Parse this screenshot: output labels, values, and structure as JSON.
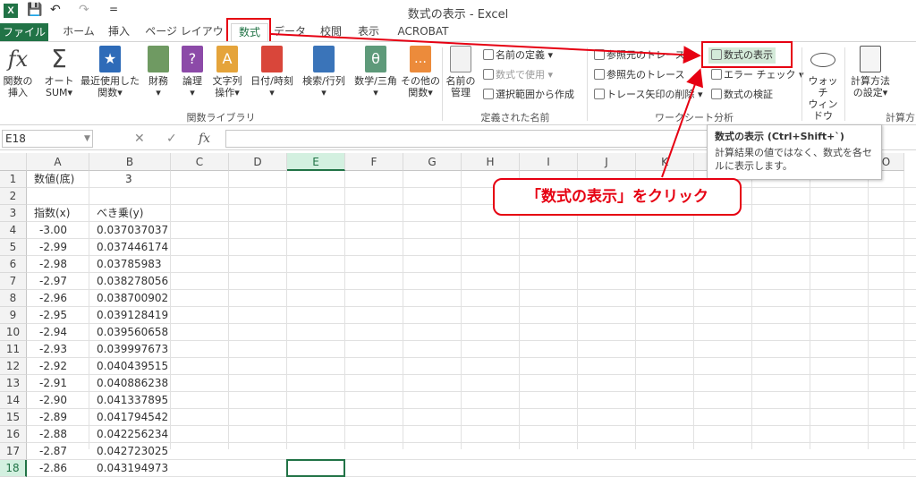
{
  "window": {
    "title": "数式の表示 - Excel",
    "app_icon_letter": "X"
  },
  "quick_access": {
    "save": "💾",
    "undo": "↶",
    "redo": "↷",
    "customize": "="
  },
  "tabs": [
    "ファイル",
    "ホーム",
    "挿入",
    "ページ レイアウト",
    "数式",
    "データ",
    "校閲",
    "表示",
    "ACROBAT"
  ],
  "ribbon": {
    "insert_function": [
      "関数の",
      "挿入"
    ],
    "autosum": [
      "オート",
      "SUM▾"
    ],
    "recent": [
      "最近使用した",
      "関数▾"
    ],
    "finance": [
      "財務",
      "▾"
    ],
    "logical": [
      "論理",
      "▾"
    ],
    "text": [
      "文字列",
      "操作▾"
    ],
    "datetime": [
      "日付/時刻",
      "▾"
    ],
    "lookup": [
      "検索/行列",
      "▾"
    ],
    "math": [
      "数学/三角",
      "▾"
    ],
    "other": [
      "その他の",
      "関数▾"
    ],
    "group_library": "関数ライブラリ",
    "name_manager": [
      "名前の",
      "管理"
    ],
    "define_name": "名前の定義 ▾",
    "use_in_formula": "数式で使用 ▾",
    "create_from_selection": "選択範囲から作成",
    "group_names": "定義された名前",
    "trace_precedents": "参照元のトレース",
    "trace_dependents": "参照先のトレース",
    "remove_arrows": "トレース矢印の削除 ▾",
    "show_formulas": "数式の表示",
    "error_check": "エラー チェック ▾",
    "evaluate_formula": "数式の検証",
    "group_audit": "ワークシート分析",
    "watch_window": [
      "ウォッチ",
      "ウィンドウ"
    ],
    "calc_options": [
      "計算方法",
      "の設定▾"
    ],
    "group_calc": "計算方"
  },
  "formula_bar": {
    "name_box": "E18",
    "fx": "fx"
  },
  "tooltip": {
    "title": "数式の表示 (Ctrl+Shift+`)",
    "body": "計算結果の値ではなく、数式を各セルに表示します。"
  },
  "callout": "「数式の表示」をクリック",
  "columns": [
    "A",
    "B",
    "C",
    "D",
    "E",
    "F",
    "G",
    "H",
    "I",
    "J",
    "K",
    "L",
    "M",
    "N",
    "O"
  ],
  "rows": [
    {
      "n": "1",
      "a": "数値(底)",
      "b": "3"
    },
    {
      "n": "2",
      "a": "",
      "b": ""
    },
    {
      "n": "3",
      "a": "指数(x)",
      "b": "べき乗(y)"
    },
    {
      "n": "4",
      "a": "-3.00",
      "b": "0.037037037"
    },
    {
      "n": "5",
      "a": "-2.99",
      "b": "0.037446174"
    },
    {
      "n": "6",
      "a": "-2.98",
      "b": "0.03785983"
    },
    {
      "n": "7",
      "a": "-2.97",
      "b": "0.038278056"
    },
    {
      "n": "8",
      "a": "-2.96",
      "b": "0.038700902"
    },
    {
      "n": "9",
      "a": "-2.95",
      "b": "0.039128419"
    },
    {
      "n": "10",
      "a": "-2.94",
      "b": "0.039560658"
    },
    {
      "n": "11",
      "a": "-2.93",
      "b": "0.039997673"
    },
    {
      "n": "12",
      "a": "-2.92",
      "b": "0.040439515"
    },
    {
      "n": "13",
      "a": "-2.91",
      "b": "0.040886238"
    },
    {
      "n": "14",
      "a": "-2.90",
      "b": "0.041337895"
    },
    {
      "n": "15",
      "a": "-2.89",
      "b": "0.041794542"
    },
    {
      "n": "16",
      "a": "-2.88",
      "b": "0.042256234"
    },
    {
      "n": "17",
      "a": "-2.87",
      "b": "0.042723025"
    },
    {
      "n": "18",
      "a": "-2.86",
      "b": "0.043194973"
    }
  ],
  "colors": {
    "excel_green": "#217346",
    "highlight_red": "#e60012"
  }
}
